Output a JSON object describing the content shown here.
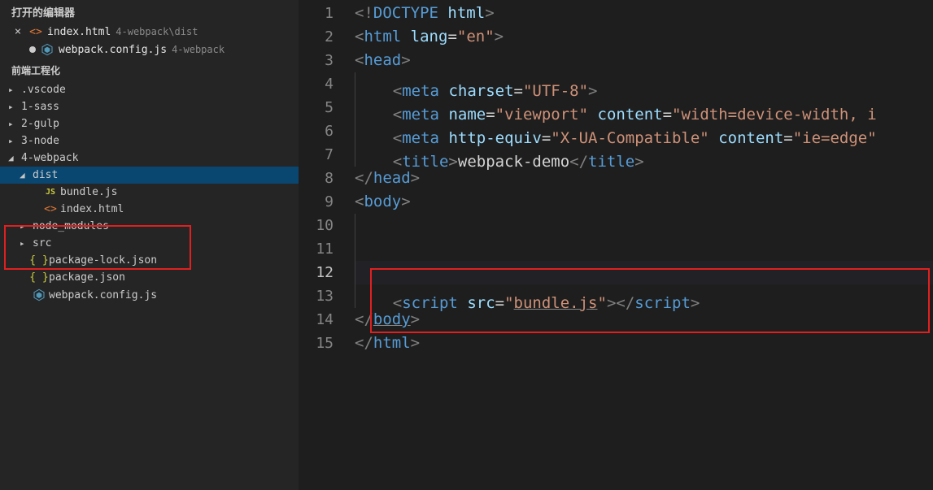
{
  "openEditors": {
    "header": "打开的编辑器",
    "items": [
      {
        "name": "index.html",
        "path": "4-webpack\\dist",
        "icon": "html",
        "modified": false,
        "showClose": true
      },
      {
        "name": "webpack.config.js",
        "path": "4-webpack",
        "icon": "webpack",
        "modified": true,
        "showClose": false
      }
    ]
  },
  "workspace": {
    "title": "前端工程化",
    "tree": [
      {
        "label": ".vscode",
        "type": "folder",
        "expanded": false,
        "depth": 0
      },
      {
        "label": "1-sass",
        "type": "folder",
        "expanded": false,
        "depth": 0
      },
      {
        "label": "2-gulp",
        "type": "folder",
        "expanded": false,
        "depth": 0
      },
      {
        "label": "3-node",
        "type": "folder",
        "expanded": false,
        "depth": 0
      },
      {
        "label": "4-webpack",
        "type": "folder",
        "expanded": true,
        "depth": 0
      },
      {
        "label": "dist",
        "type": "folder",
        "expanded": true,
        "depth": 1,
        "selected": true
      },
      {
        "label": "bundle.js",
        "type": "file",
        "icon": "js",
        "depth": 2
      },
      {
        "label": "index.html",
        "type": "file",
        "icon": "html",
        "depth": 2
      },
      {
        "label": "node_modules",
        "type": "folder",
        "expanded": false,
        "depth": 1
      },
      {
        "label": "src",
        "type": "folder",
        "expanded": false,
        "depth": 1
      },
      {
        "label": "package-lock.json",
        "type": "file",
        "icon": "json",
        "depth": 1
      },
      {
        "label": "package.json",
        "type": "file",
        "icon": "json",
        "depth": 1
      },
      {
        "label": "webpack.config.js",
        "type": "file",
        "icon": "webpack",
        "depth": 1
      }
    ]
  },
  "code": {
    "currentLine": 12,
    "lines": [
      {
        "n": 1,
        "html": "<span class='p-gray'>&lt;!</span><span class='p-tag'>DOCTYPE</span> <span class='p-attr'>html</span><span class='p-gray'>&gt;</span>"
      },
      {
        "n": 2,
        "html": "<span class='p-gray'>&lt;</span><span class='p-tag'>html</span> <span class='p-attr'>lang</span><span class='p-txt'>=</span><span class='p-str'>\"en\"</span><span class='p-gray'>&gt;</span>"
      },
      {
        "n": 3,
        "html": "<span class='p-gray'>&lt;</span><span class='p-tag'>head</span><span class='p-gray'>&gt;</span>"
      },
      {
        "n": 4,
        "html": "<span class='guide'></span>    <span class='p-gray'>&lt;</span><span class='p-tag'>meta</span> <span class='p-attr'>charset</span><span class='p-txt'>=</span><span class='p-str'>\"UTF-8\"</span><span class='p-gray'>&gt;</span>"
      },
      {
        "n": 5,
        "html": "<span class='guide'></span>    <span class='p-gray'>&lt;</span><span class='p-tag'>meta</span> <span class='p-attr'>name</span><span class='p-txt'>=</span><span class='p-str'>\"viewport\"</span> <span class='p-attr'>content</span><span class='p-txt'>=</span><span class='p-str'>\"width=device-width, i</span>"
      },
      {
        "n": 6,
        "html": "<span class='guide'></span>    <span class='p-gray'>&lt;</span><span class='p-tag'>meta</span> <span class='p-attr'>http-equiv</span><span class='p-txt'>=</span><span class='p-str'>\"X-UA-Compatible\"</span> <span class='p-attr'>content</span><span class='p-txt'>=</span><span class='p-str'>\"ie=edge\"</span>"
      },
      {
        "n": 7,
        "html": "<span class='guide'></span>    <span class='p-gray'>&lt;</span><span class='p-tag'>title</span><span class='p-gray'>&gt;</span><span class='p-txt'>webpack-demo</span><span class='p-gray'>&lt;/</span><span class='p-tag'>title</span><span class='p-gray'>&gt;</span>"
      },
      {
        "n": 8,
        "html": "<span class='p-gray'>&lt;/</span><span class='p-tag'>head</span><span class='p-gray'>&gt;</span>"
      },
      {
        "n": 9,
        "html": "<span class='p-gray'>&lt;</span><span class='p-tag'>body</span><span class='p-gray'>&gt;</span>"
      },
      {
        "n": 10,
        "html": "<span class='guide'></span>"
      },
      {
        "n": 11,
        "html": "<span class='guide'></span>"
      },
      {
        "n": 12,
        "html": "<span class='guide'></span>"
      },
      {
        "n": 13,
        "html": "<span class='guide'></span>    <span class='p-gray'>&lt;</span><span class='p-tag'>script</span> <span class='p-attr'>src</span><span class='p-txt'>=</span><span class='p-str'>\"<span class='p-underline'>bundle.js</span>\"</span><span class='p-gray'>&gt;&lt;/</span><span class='p-tag'>script</span><span class='p-gray'>&gt;</span>"
      },
      {
        "n": 14,
        "html": "<span class='p-gray'>&lt;/</span><span class='p-tag p-underline'>body</span><span class='p-gray'>&gt;</span>"
      },
      {
        "n": 15,
        "html": "<span class='p-gray'>&lt;/</span><span class='p-tag'>html</span><span class='p-gray'>&gt;</span>"
      }
    ]
  }
}
